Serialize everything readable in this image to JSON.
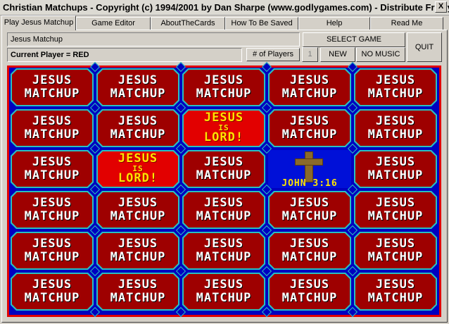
{
  "window": {
    "title": "Christian Matchups - Copyright (c) 1994/2001 by Dan Sharpe (www.godlygames.com) - Distribute Freely!.",
    "close": "X"
  },
  "tabs": [
    {
      "label": "Play Jesus Matchup"
    },
    {
      "label": "Game Editor"
    },
    {
      "label": "AboutTheCards"
    },
    {
      "label": "How To Be Saved"
    },
    {
      "label": "Help"
    },
    {
      "label": "Read Me"
    }
  ],
  "game": {
    "name": "Jesus Matchup",
    "current_player": "Current Player = RED",
    "players_label": "# of Players",
    "players_value": "1"
  },
  "controls": {
    "select_game": "SELECT GAME",
    "new": "NEW",
    "no_music": "NO MUSIC",
    "quit": "QUIT"
  },
  "card_back": {
    "line1": "JESUS",
    "line2": "MATCHUP"
  },
  "card_lord": {
    "line1": "JESUS",
    "line2": "IS",
    "line3": "LORD!"
  },
  "card_cross": {
    "verse": "JOHN 3:16"
  },
  "board": {
    "rows": 6,
    "cols": 5,
    "face_up": [
      {
        "row": 1,
        "col": 2,
        "type": "lord"
      },
      {
        "row": 2,
        "col": 1,
        "type": "lord"
      },
      {
        "row": 2,
        "col": 3,
        "type": "cross"
      }
    ]
  },
  "colors": {
    "border_red": "#e00000",
    "board_blue": "#0000c0",
    "card_red": "#9e0000",
    "card_edge": "#28c0c0",
    "gold": "#ffe400"
  }
}
